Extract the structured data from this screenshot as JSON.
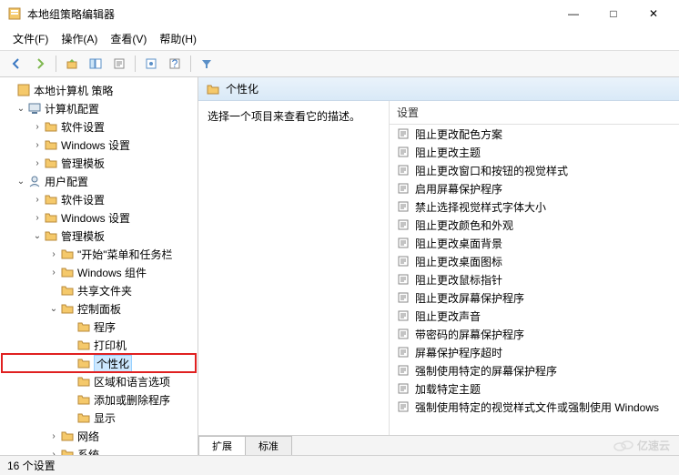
{
  "window": {
    "title": "本地组策略编辑器",
    "min": "—",
    "max": "□",
    "close": "✕"
  },
  "menu": {
    "file": "文件(F)",
    "action": "操作(A)",
    "view": "查看(V)",
    "help": "帮助(H)"
  },
  "tree": {
    "root": "本地计算机 策略",
    "computer": "计算机配置",
    "c_software": "软件设置",
    "c_windows": "Windows 设置",
    "c_admin": "管理模板",
    "user": "用户配置",
    "u_software": "软件设置",
    "u_windows": "Windows 设置",
    "u_admin": "管理模板",
    "start_taskbar": "\"开始\"菜单和任务栏",
    "win_components": "Windows 组件",
    "shared_folders": "共享文件夹",
    "control_panel": "控制面板",
    "programs": "程序",
    "printers": "打印机",
    "personalization": "个性化",
    "region_lang": "区域和语言选项",
    "add_remove": "添加或删除程序",
    "display": "显示",
    "network": "网络",
    "system": "系统"
  },
  "content": {
    "heading": "个性化",
    "description": "选择一个项目来查看它的描述。",
    "settings_header": "设置",
    "items": [
      "阻止更改配色方案",
      "阻止更改主题",
      "阻止更改窗口和按钮的视觉样式",
      "启用屏幕保护程序",
      "禁止选择视觉样式字体大小",
      "阻止更改颜色和外观",
      "阻止更改桌面背景",
      "阻止更改桌面图标",
      "阻止更改鼠标指针",
      "阻止更改屏幕保护程序",
      "阻止更改声音",
      "带密码的屏幕保护程序",
      "屏幕保护程序超时",
      "强制使用特定的屏幕保护程序",
      "加载特定主题",
      "强制使用特定的视觉样式文件或强制使用 Windows"
    ]
  },
  "tabs": {
    "extended": "扩展",
    "standard": "标准"
  },
  "status": "16 个设置",
  "watermark": "亿速云"
}
